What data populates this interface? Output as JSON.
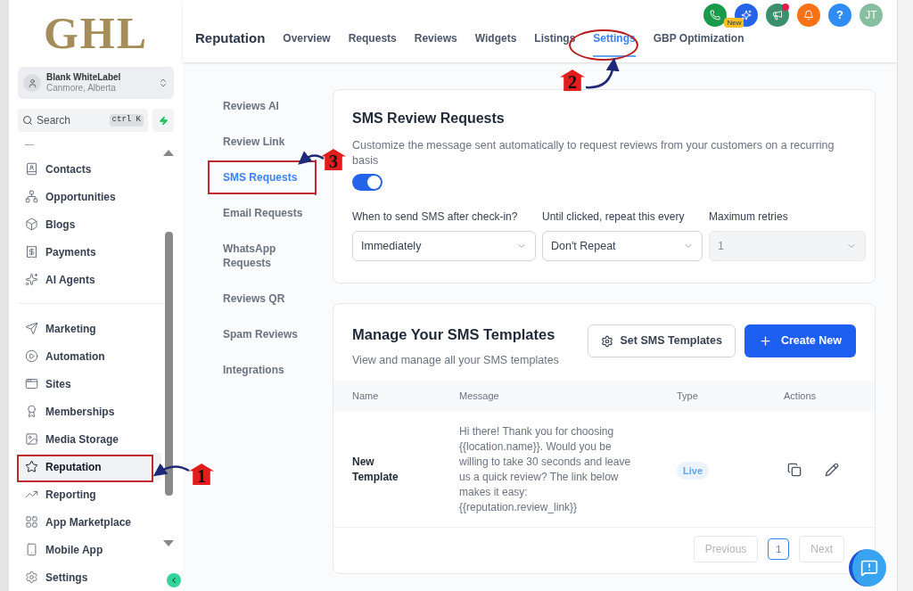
{
  "logo": "GHL",
  "account": {
    "name": "Blank WhiteLabel",
    "location": "Canmore, Alberta"
  },
  "search": {
    "placeholder": "Search",
    "shortcut": "ctrl K"
  },
  "nav_groups": [
    [
      {
        "label": "Contacts",
        "selected": false
      },
      {
        "label": "Opportunities",
        "selected": false
      },
      {
        "label": "Blogs",
        "selected": false
      },
      {
        "label": "Payments",
        "selected": false
      },
      {
        "label": "AI Agents",
        "selected": false
      }
    ],
    [
      {
        "label": "Marketing",
        "selected": false
      },
      {
        "label": "Automation",
        "selected": false
      },
      {
        "label": "Sites",
        "selected": false
      },
      {
        "label": "Memberships",
        "selected": false
      },
      {
        "label": "Media Storage",
        "selected": false
      },
      {
        "label": "Reputation",
        "selected": true
      },
      {
        "label": "Reporting",
        "selected": false
      },
      {
        "label": "App Marketplace",
        "selected": false
      },
      {
        "label": "Mobile App",
        "selected": false
      },
      {
        "label": "Settings",
        "selected": false
      }
    ]
  ],
  "topbar": {
    "help": "?",
    "avatar": "JT"
  },
  "header": {
    "title": "Reputation",
    "tabs": [
      {
        "label": "Overview",
        "selected": false
      },
      {
        "label": "Requests",
        "selected": false
      },
      {
        "label": "Reviews",
        "selected": false
      },
      {
        "label": "Widgets",
        "selected": false
      },
      {
        "label": "Listings",
        "selected": false
      },
      {
        "label": "Settings",
        "selected": true
      },
      {
        "label": "GBP Optimization",
        "selected": false,
        "badge": "New"
      }
    ]
  },
  "subnav": [
    {
      "label": "Reviews AI",
      "selected": false
    },
    {
      "label": "Review Link",
      "selected": false
    },
    {
      "label": "SMS Requests",
      "selected": true
    },
    {
      "label": "Email Requests",
      "selected": false
    },
    {
      "label": "WhatsApp Requests",
      "selected": false
    },
    {
      "label": "Reviews QR",
      "selected": false
    },
    {
      "label": "Spam Reviews",
      "selected": false
    },
    {
      "label": "Integrations",
      "selected": false
    }
  ],
  "sms_settings": {
    "title": "SMS Review Requests",
    "description": "Customize the message sent automatically to request reviews from your customers on a recurring basis",
    "enabled": true,
    "fields": [
      {
        "label": "When to send SMS after check-in?",
        "value": "Immediately",
        "disabled": false
      },
      {
        "label": "Until clicked, repeat this every",
        "value": "Don't Repeat",
        "disabled": false
      },
      {
        "label": "Maximum retries",
        "value": "1",
        "disabled": true
      }
    ]
  },
  "templates": {
    "title": "Manage Your SMS Templates",
    "subtitle": "View and manage all your SMS templates",
    "set_button": "Set SMS Templates",
    "create_button": "Create New",
    "columns": [
      "Name",
      "Message",
      "Type",
      "Actions"
    ],
    "rows": [
      {
        "name": "New Template",
        "message": "Hi there! Thank you for choosing {{location.name}}. Would you be willing to take 30 seconds and leave us a quick review? The link below makes it easy: {{reputation.review_link}}",
        "type": "Live"
      }
    ],
    "pagination": {
      "previous": "Previous",
      "pages": [
        {
          "label": "1",
          "selected": true
        }
      ],
      "next": "Next"
    }
  },
  "annotations": [
    {
      "number": "1"
    },
    {
      "number": "2"
    },
    {
      "number": "3"
    }
  ]
}
